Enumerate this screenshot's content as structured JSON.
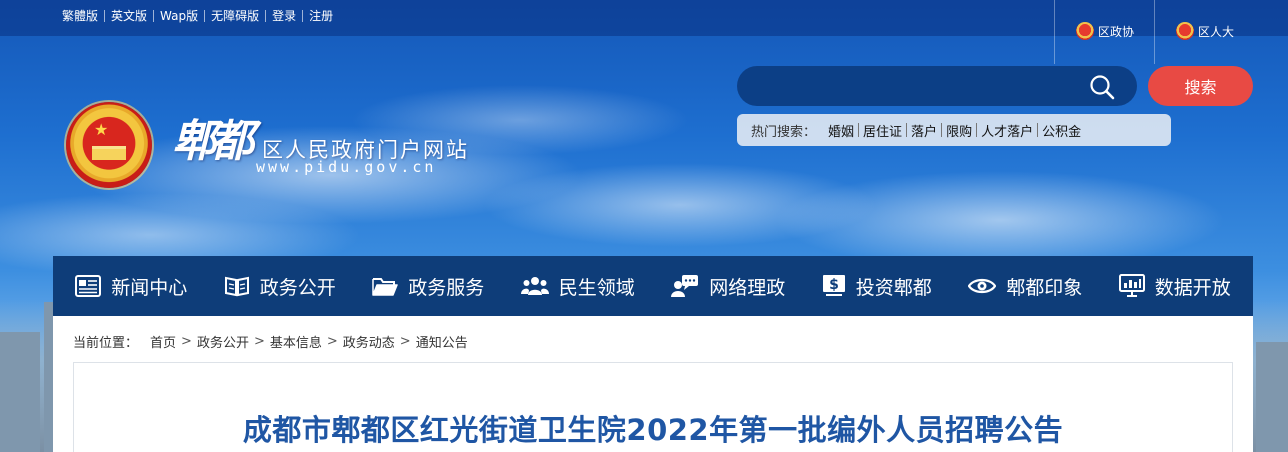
{
  "top_links": [
    "繁體版",
    "英文版",
    "Wap版",
    "无障碍版",
    "登录",
    "注册"
  ],
  "right_links": {
    "district_cppcc": "区政协",
    "district_npc": "区人大"
  },
  "site": {
    "calligraphy": "郫都",
    "title": "区人民政府门户网站",
    "url": "www.pidu.gov.cn"
  },
  "search": {
    "placeholder": "",
    "button": "搜索",
    "hot_label": "热门搜索：",
    "hot_terms": [
      "婚姻",
      "居住证",
      "落户",
      "限购",
      "人才落户",
      "公积金"
    ]
  },
  "nav": [
    {
      "label": "新闻中心",
      "icon": "newspaper-icon"
    },
    {
      "label": "政务公开",
      "icon": "book-icon"
    },
    {
      "label": "政务服务",
      "icon": "folder-icon"
    },
    {
      "label": "民生领域",
      "icon": "people-icon"
    },
    {
      "label": "网络理政",
      "icon": "chat-user-icon"
    },
    {
      "label": "投资郫都",
      "icon": "dollar-icon"
    },
    {
      "label": "郫都印象",
      "icon": "eye-icon"
    },
    {
      "label": "数据开放",
      "icon": "monitor-icon"
    }
  ],
  "breadcrumb": {
    "label": "当前位置：",
    "items": [
      "首页",
      "政务公开",
      "基本信息",
      "政务动态",
      "通知公告"
    ]
  },
  "article": {
    "title": "成都市郫都区红光街道卫生院2022年第一批编外人员招聘公告"
  },
  "colors": {
    "nav_bg": "#0e3d79",
    "search_bg": "#0c3f86",
    "search_button": "#e84a44",
    "title_blue": "#1f56a4"
  }
}
